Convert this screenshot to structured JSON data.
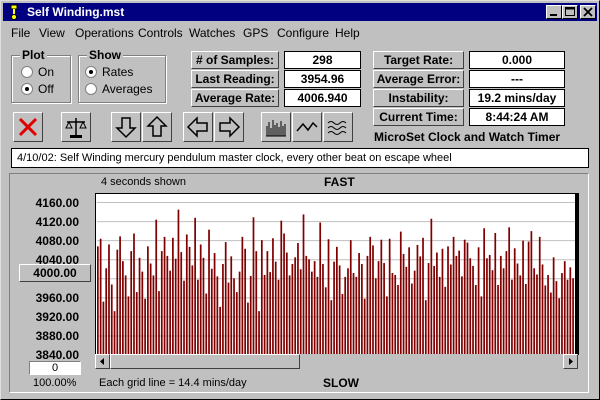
{
  "window": {
    "title": "Self Winding.mst"
  },
  "menu": [
    "File",
    "View",
    "Operations",
    "Controls",
    "Watches",
    "GPS",
    "Configure",
    "Help"
  ],
  "plot_group": {
    "title": "Plot",
    "options": [
      "On",
      "Off"
    ],
    "selected": "Off"
  },
  "show_group": {
    "title": "Show",
    "options": [
      "Rates",
      "Averages"
    ],
    "selected": "Rates"
  },
  "stats": {
    "samples_label": "# of Samples:",
    "samples_value": "298",
    "last_label": "Last Reading:",
    "last_value": "3954.96",
    "avg_label": "Average Rate:",
    "avg_value": "4006.940",
    "target_label": "Target Rate:",
    "target_value": "0.000",
    "avg_error_label": "Average Error:",
    "avg_error_value": "---",
    "instability_label": "Instability:",
    "instability_value": "19.2 mins/day",
    "time_label": "Current Time:",
    "time_value": "8:44:24 AM"
  },
  "app_name": "MicroSet Clock and Watch Timer",
  "note": "4/10/02: Self Winding mercury pendulum  master clock, every other beat on escape wheel",
  "chart_header": {
    "seconds_shown": "4 seconds shown",
    "fast": "FAST",
    "slow": "SLOW"
  },
  "center_button": "4000.00",
  "offset_box": "0",
  "zoom": "100.00%",
  "grid_note": "Each grid line = 14.4 mins/day",
  "chart_data": {
    "type": "bar",
    "title": "",
    "ylim": [
      3840,
      4180
    ],
    "yticks": [
      "4160.00",
      "4120.00",
      "4080.00",
      "4040.00",
      "4000.00",
      "3960.00",
      "3920.00",
      "3880.00",
      "3840.00"
    ],
    "color": "#800000",
    "values": [
      4068,
      4084,
      3952,
      4022,
      4072,
      3988,
      3932,
      4061,
      4089,
      4037,
      4007,
      3963,
      4058,
      4095,
      3972,
      4044,
      4015,
      3958,
      4068,
      4032,
      4007,
      4124,
      3974,
      4058,
      4088,
      4048,
      4017,
      4086,
      4042,
      4145,
      4056,
      3996,
      4093,
      4067,
      4028,
      4128,
      3998,
      4072,
      4044,
      3969,
      4103,
      4021,
      4054,
      4005,
      3941,
      4031,
      4077,
      3992,
      4047,
      4001,
      3972,
      4015,
      4088,
      4063,
      3950,
      4006,
      4129,
      4058,
      3932,
      4081,
      4008,
      4058,
      4014,
      4085,
      4036,
      3998,
      4122,
      4095,
      4055,
      4007,
      4031,
      4045,
      4075,
      4020,
      4135,
      4048,
      4041,
      4015,
      4037,
      4004,
      4118,
      4031,
      3982,
      4083,
      3955,
      4036,
      4067,
      4028,
      3968,
      4004,
      4022,
      4081,
      4012,
      4004,
      4054,
      4031,
      3958,
      4048,
      4088,
      4070,
      4001,
      4037,
      4082,
      4033,
      3963,
      4084,
      4012,
      4008,
      3987,
      4099,
      4052,
      4025,
      4066,
      3990,
      4017,
      4071,
      4047,
      4086,
      3955,
      4033,
      4126,
      4027,
      4055,
      4004,
      4063,
      3983,
      4068,
      4030,
      4088,
      4048,
      4059,
      4005,
      4082,
      4076,
      4043,
      4027,
      3987,
      4066,
      3963,
      4106,
      4043,
      4050,
      4018,
      4096,
      3987,
      4048,
      4022,
      4058,
      4108,
      3998,
      4064,
      4032,
      4007,
      4080,
      3989,
      4078,
      4100,
      4022,
      4009,
      4088,
      4030,
      3986,
      4008,
      3971,
      4045,
      3995,
      3959,
      4012,
      4037,
      3998,
      4024,
      4001
    ]
  }
}
